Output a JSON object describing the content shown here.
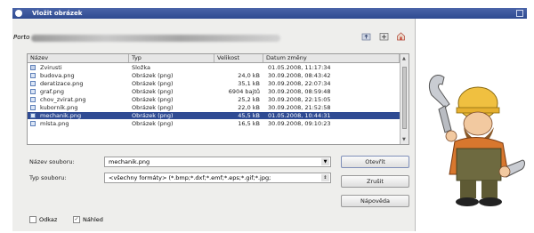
{
  "window": {
    "title": "Vložit obrázek"
  },
  "path": {
    "label": "Porto"
  },
  "columns": {
    "name": "Název",
    "type": "Typ",
    "size": "Velikost",
    "date": "Datum změny"
  },
  "files": [
    {
      "name": "Zvirusti",
      "type": "Složka",
      "size": "",
      "date": "01.05.2008, 11:17:34",
      "folder": true
    },
    {
      "name": "budova.png",
      "type": "Obrázek (png)",
      "size": "24,0 kB",
      "date": "30.09.2008, 08:43:42"
    },
    {
      "name": "deratizace.png",
      "type": "Obrázek (png)",
      "size": "35,1 kB",
      "date": "30.09.2008, 22:07:34"
    },
    {
      "name": "graf.png",
      "type": "Obrázek (png)",
      "size": "6904 bajtů",
      "date": "30.09.2008, 08:59:48"
    },
    {
      "name": "chov_zvirat.png",
      "type": "Obrázek (png)",
      "size": "25,2 kB",
      "date": "30.09.2008, 22:15:05"
    },
    {
      "name": "kuborník.png",
      "type": "Obrázek (png)",
      "size": "22,0 kB",
      "date": "30.09.2008, 21:52:58"
    },
    {
      "name": "mechanik.png",
      "type": "Obrázek (png)",
      "size": "45,5 kB",
      "date": "01.05.2008, 10:44:31",
      "selected": true
    },
    {
      "name": "místa.png",
      "type": "Obrázek (png)",
      "size": "16,5 kB",
      "date": "30.09.2008, 09:10:23"
    }
  ],
  "form": {
    "filename_label": "Název souboru:",
    "filename_value": "mechanik.png",
    "filetype_label": "Typ souboru:",
    "filetype_value": "<všechny formáty> (*.bmp;*.dxf;*.emf;*.eps;*.gif;*.jpg;"
  },
  "buttons": {
    "open": "Otevřít",
    "cancel": "Zrušit",
    "help": "Nápověda"
  },
  "checkboxes": {
    "link_label": "Odkaz",
    "link_checked": false,
    "preview_label": "Náhled",
    "preview_checked": true
  },
  "colors": {
    "titlebar": "#2e4a90",
    "selection": "#2f4b93",
    "dialog_bg": "#eeeeec"
  }
}
